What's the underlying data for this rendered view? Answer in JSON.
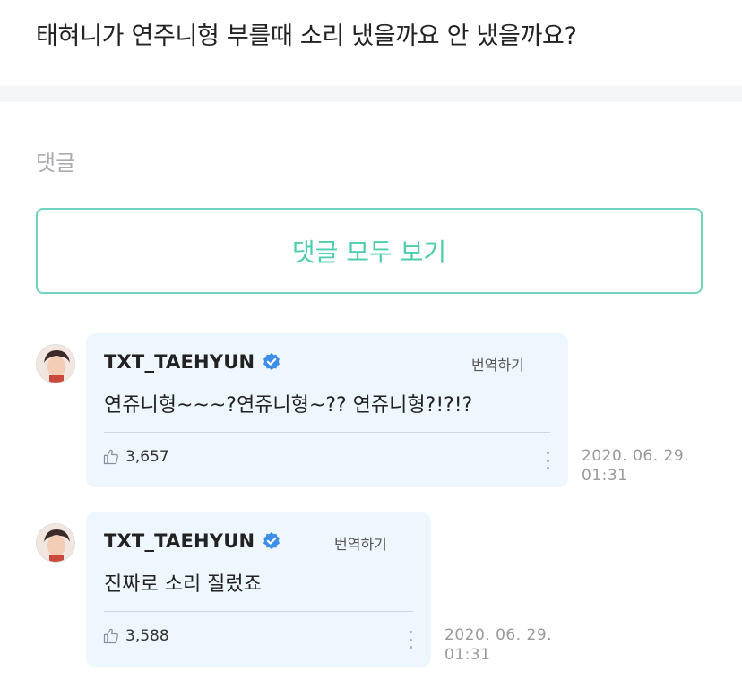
{
  "post": {
    "title": "태혀니가 연주니형 부를때 소리 냈을까요 안 냈을까요?"
  },
  "comments_section": {
    "title": "댓글",
    "view_all_label": "댓글 모두 보기"
  },
  "comments": [
    {
      "author": "TXT_TAEHYUN",
      "verified": true,
      "translate_label": "번역하기",
      "text": "연쥬니형~~~?연쥬니형~?? 연쥬니형?!?!?",
      "likes": "3,657",
      "date": "2020. 06. 29.",
      "time": "01:31"
    },
    {
      "author": "TXT_TAEHYUN",
      "verified": true,
      "translate_label": "번역하기",
      "text": "진짜로 소리 질렀죠",
      "likes": "3,588",
      "date": "2020. 06. 29.",
      "time": "01:31"
    }
  ],
  "colors": {
    "accent": "#4fcdb0",
    "bubble": "#eef7fd",
    "verified": "#3d8ee8"
  },
  "icons": [
    "verified-badge-icon",
    "thumbs-up-icon",
    "more-options-icon",
    "avatar-image"
  ]
}
